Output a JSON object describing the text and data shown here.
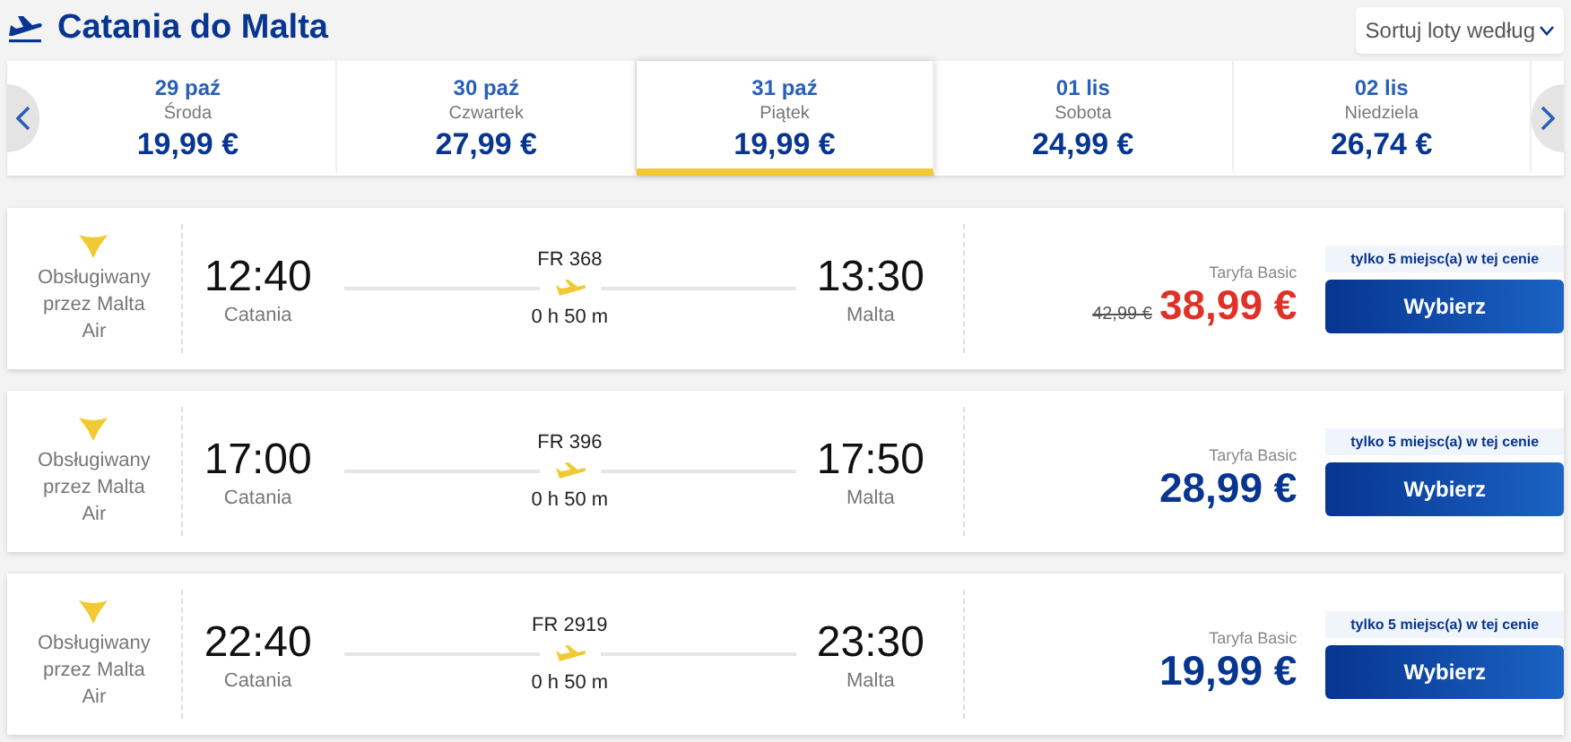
{
  "header": {
    "title": "Catania do Malta",
    "sort_label": "Sortuj loty według"
  },
  "dates": [
    {
      "date": "29 paź",
      "day": "Środa",
      "price": "19,99 €",
      "selected": false
    },
    {
      "date": "30 paź",
      "day": "Czwartek",
      "price": "27,99 €",
      "selected": false
    },
    {
      "date": "31 paź",
      "day": "Piątek",
      "price": "19,99 €",
      "selected": true
    },
    {
      "date": "01 lis",
      "day": "Sobota",
      "price": "24,99 €",
      "selected": false
    },
    {
      "date": "02 lis",
      "day": "Niedziela",
      "price": "26,74 €",
      "selected": false
    }
  ],
  "flights": [
    {
      "operator": "Obsługiwany przez Malta Air",
      "depart_time": "12:40",
      "depart_city": "Catania",
      "flight_no": "FR 368",
      "duration": "0 h 50 m",
      "arrive_time": "13:30",
      "arrive_city": "Malta",
      "fare": "Taryfa Basic",
      "old_price": "42,99 €",
      "price": "38,99 €",
      "discounted": true,
      "seats_note": "tylko 5 miejsc(a) w tej cenie",
      "button": "Wybierz"
    },
    {
      "operator": "Obsługiwany przez Malta Air",
      "depart_time": "17:00",
      "depart_city": "Catania",
      "flight_no": "FR 396",
      "duration": "0 h 50 m",
      "arrive_time": "17:50",
      "arrive_city": "Malta",
      "fare": "Taryfa Basic",
      "price": "28,99 €",
      "discounted": false,
      "seats_note": "tylko 5 miejsc(a) w tej cenie",
      "button": "Wybierz"
    },
    {
      "operator": "Obsługiwany przez Malta Air",
      "depart_time": "22:40",
      "depart_city": "Catania",
      "flight_no": "FR 2919",
      "duration": "0 h 50 m",
      "arrive_time": "23:30",
      "arrive_city": "Malta",
      "fare": "Taryfa Basic",
      "price": "19,99 €",
      "discounted": false,
      "seats_note": "tylko 5 miejsc(a) w tej cenie",
      "button": "Wybierz"
    }
  ]
}
